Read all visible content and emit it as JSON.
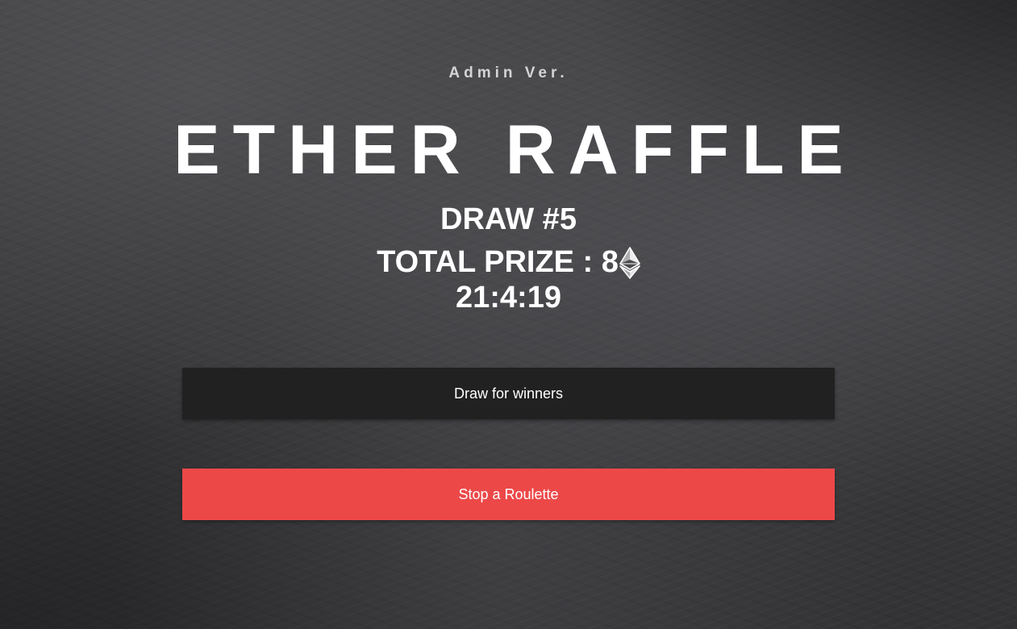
{
  "header": {
    "subtitle": "Admin Ver.",
    "title": "ETHER RAFFLE"
  },
  "raffle": {
    "draw_label": "DRAW #5",
    "prize_label": "TOTAL PRIZE : 8",
    "prize_icon": "ethereum-icon",
    "timer": "21:4:19"
  },
  "actions": {
    "draw_button_label": "Draw for winners",
    "stop_button_label": "Stop a Roulette"
  },
  "colors": {
    "draw_button": "#212121",
    "stop_button": "#ec4848",
    "background": "#3a3a3c"
  }
}
